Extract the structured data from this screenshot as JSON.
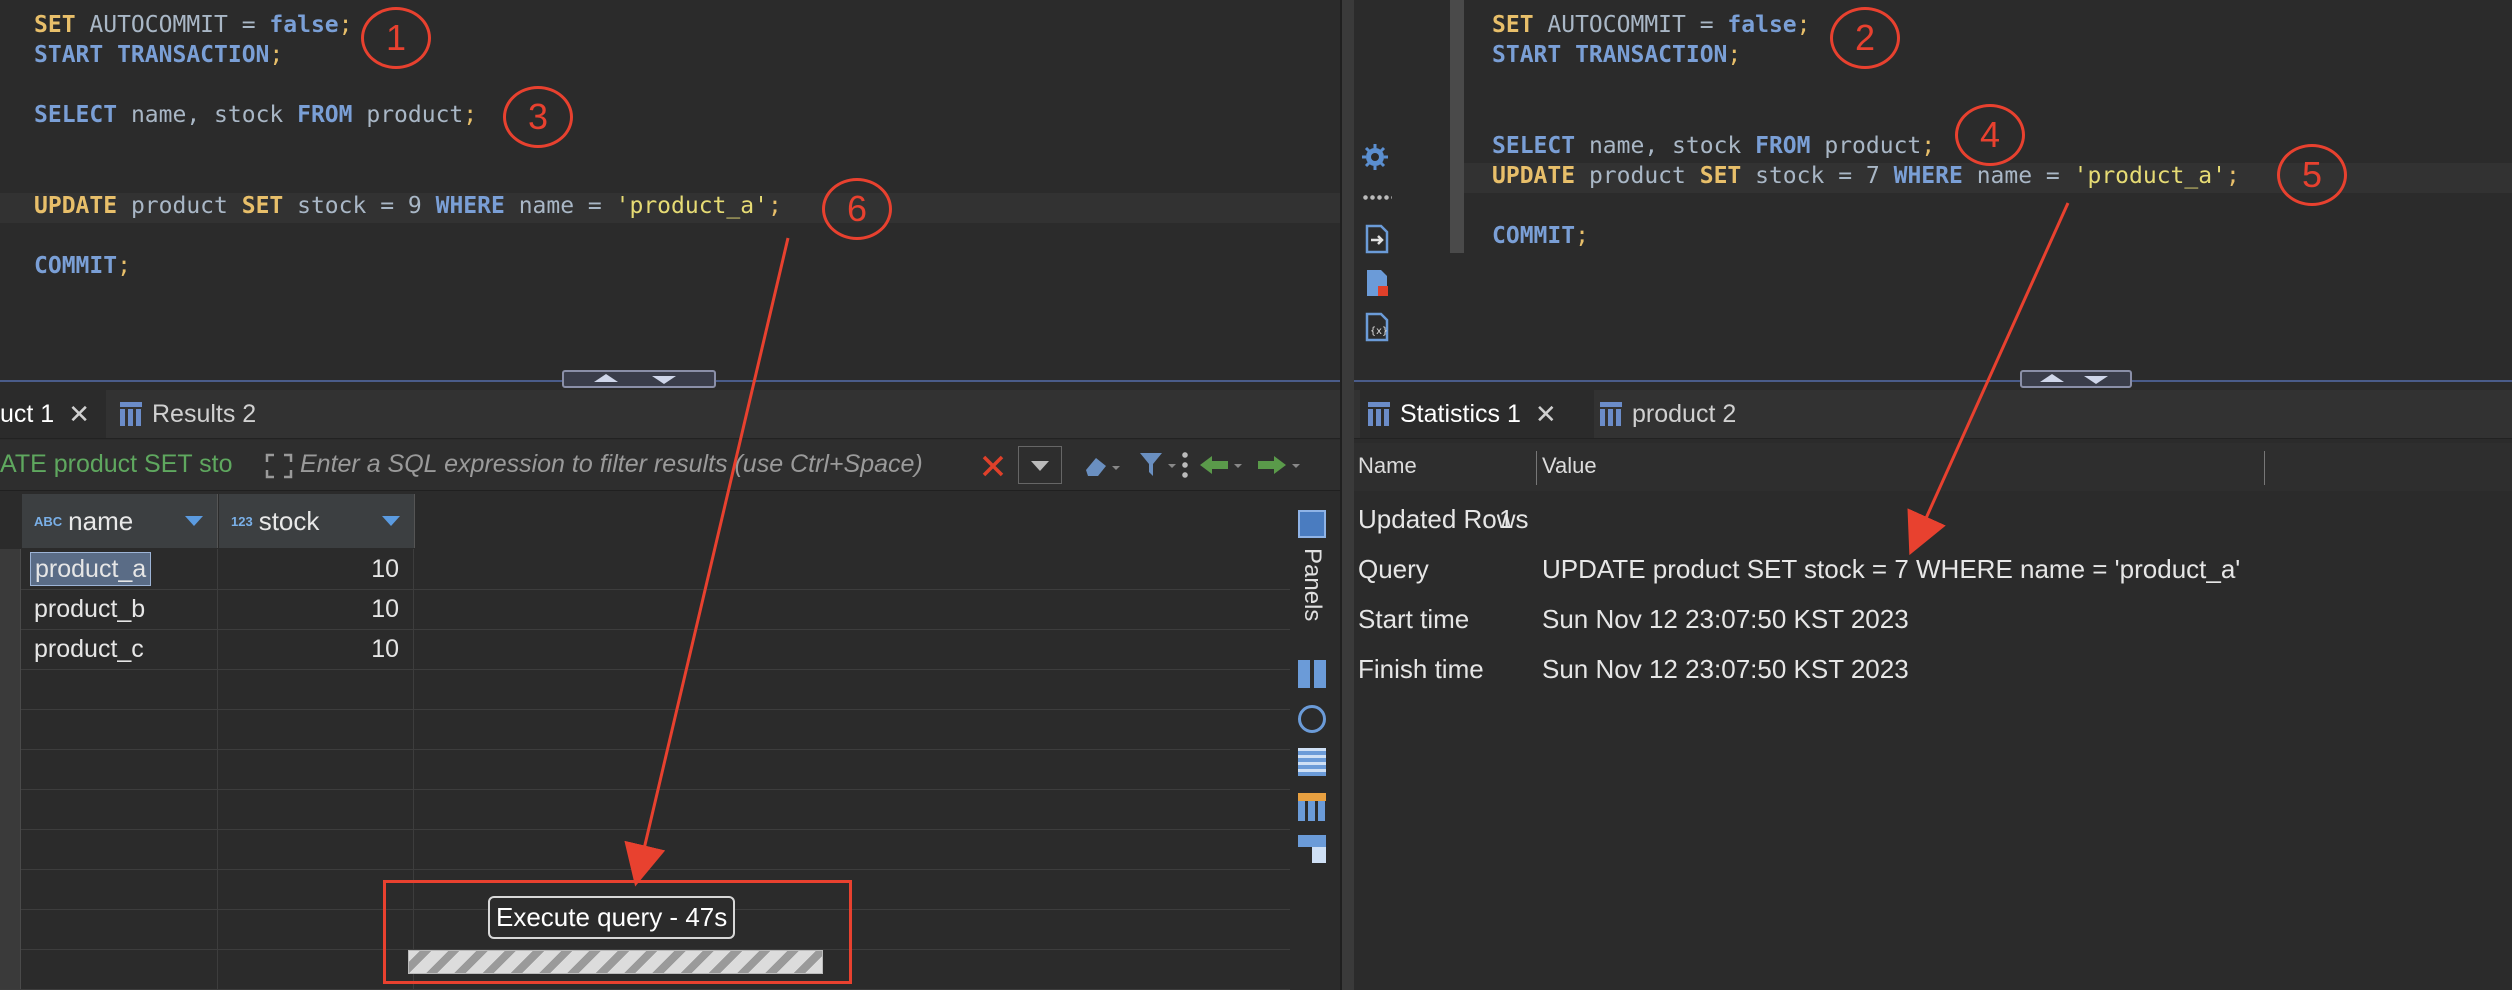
{
  "left_editor": {
    "lines": [
      {
        "tokens": [
          [
            "kw",
            "SET"
          ],
          [
            "idn",
            " AUTOCOMMIT = "
          ],
          [
            "val",
            "false"
          ],
          [
            "punc",
            ";"
          ]
        ]
      },
      {
        "tokens": [
          [
            "kb",
            "START TRANSACTION"
          ],
          [
            "punc",
            ";"
          ]
        ]
      },
      {
        "tokens": [
          [
            "kb",
            "SELECT"
          ],
          [
            "idn",
            " name, stock "
          ],
          [
            "kb",
            "FROM"
          ],
          [
            "idn",
            " product"
          ],
          [
            "punc",
            ";"
          ]
        ]
      },
      {
        "tokens": [
          [
            "kw",
            "UPDATE"
          ],
          [
            "idn",
            " product "
          ],
          [
            "kw",
            "SET"
          ],
          [
            "idn",
            " stock = 9 "
          ],
          [
            "kb",
            "WHERE"
          ],
          [
            "idn",
            " name = "
          ],
          [
            "str",
            "'product_a'"
          ],
          [
            "punc",
            ";"
          ]
        ]
      },
      {
        "tokens": [
          [
            "kb",
            "COMMIT"
          ],
          [
            "punc",
            ";"
          ]
        ]
      }
    ]
  },
  "right_editor": {
    "lines": [
      {
        "tokens": [
          [
            "kw",
            "SET"
          ],
          [
            "idn",
            " AUTOCOMMIT = "
          ],
          [
            "val",
            "false"
          ],
          [
            "punc",
            ";"
          ]
        ]
      },
      {
        "tokens": [
          [
            "kb",
            "START TRANSACTION"
          ],
          [
            "punc",
            ";"
          ]
        ]
      },
      {
        "tokens": [
          [
            "kb",
            "SELECT"
          ],
          [
            "idn",
            " name, stock "
          ],
          [
            "kb",
            "FROM"
          ],
          [
            "idn",
            " product"
          ],
          [
            "punc",
            ";"
          ]
        ]
      },
      {
        "tokens": [
          [
            "kw",
            "UPDATE"
          ],
          [
            "idn",
            " product "
          ],
          [
            "kw",
            "SET"
          ],
          [
            "idn",
            " stock = 7 "
          ],
          [
            "kb",
            "WHERE"
          ],
          [
            "idn",
            " name = "
          ],
          [
            "str",
            "'product_a'"
          ],
          [
            "punc",
            ";"
          ]
        ]
      },
      {
        "tokens": [
          [
            "kb",
            "COMMIT"
          ],
          [
            "punc",
            ";"
          ]
        ]
      }
    ]
  },
  "annotations": [
    "1",
    "2",
    "3",
    "4",
    "5",
    "6"
  ],
  "left_tabs": {
    "active": "uct 1",
    "other": "Results 2"
  },
  "left_filter": {
    "sql_text": "ATE product SET sto",
    "placeholder": "Enter a SQL expression to filter results (use Ctrl+Space)"
  },
  "left_grid": {
    "columns": [
      {
        "type": "ABC",
        "name": "name"
      },
      {
        "type": "123",
        "name": "stock"
      }
    ],
    "rows": [
      [
        "product_a",
        "10"
      ],
      [
        "product_b",
        "10"
      ],
      [
        "product_c",
        "10"
      ]
    ],
    "panels_label": "Panels"
  },
  "exec_status": {
    "label": "Execute query - 47s"
  },
  "right_tabs": {
    "active": "Statistics 1",
    "other": "product 2"
  },
  "right_stats": {
    "columns": [
      "Name",
      "Value"
    ],
    "rows": [
      [
        "Updated Rows",
        "1"
      ],
      [
        "Query",
        "UPDATE product SET stock = 7 WHERE name = 'product_a'"
      ],
      [
        "Start time",
        "Sun Nov 12 23:07:50 KST 2023"
      ],
      [
        "Finish time",
        "Sun Nov 12 23:07:50 KST 2023"
      ]
    ]
  },
  "colors": {
    "annotation": "#e8412f",
    "accent": "#5b9be0"
  }
}
